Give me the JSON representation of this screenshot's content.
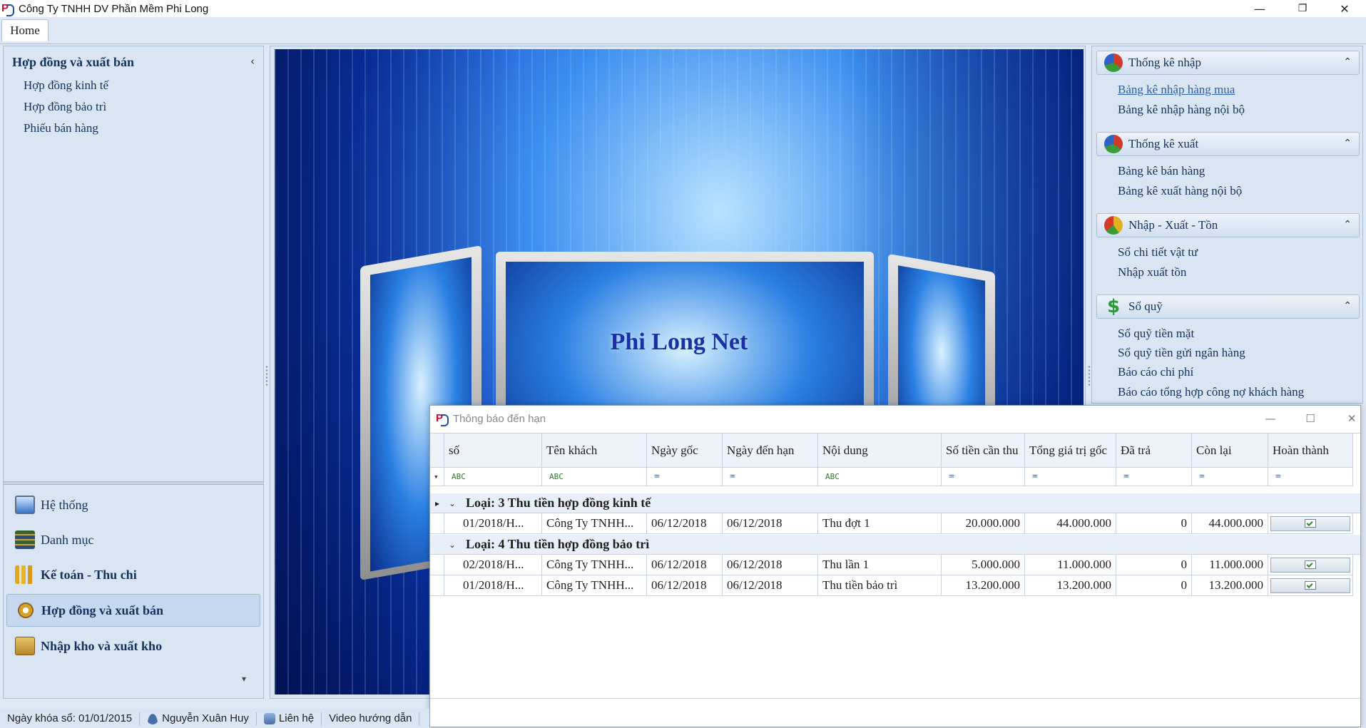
{
  "window": {
    "title": "Công Ty TNHH DV Phần Mềm Phi Long",
    "minimize": "—",
    "restore": "❐",
    "close": "✕"
  },
  "ribbon": {
    "home_tab": "Home"
  },
  "left_panel": {
    "heading": "Hợp đồng và xuất bán",
    "collapse_glyph": "‹",
    "links": [
      "Hợp đồng kinh tế",
      "Hợp đồng bảo trì",
      "Phiếu bán hàng"
    ],
    "modules": [
      {
        "label": "Hệ thống",
        "icon": "computer-icon"
      },
      {
        "label": "Danh mục",
        "icon": "books-icon"
      },
      {
        "label": "Kế toán - Thu chi",
        "icon": "chart-bars-icon"
      },
      {
        "label": "Hợp đồng và xuất bán",
        "icon": "gear-icon",
        "active": true
      },
      {
        "label": "Nhập kho và xuất kho",
        "icon": "warehouse-box-icon"
      }
    ],
    "scroll_glyph": "▾"
  },
  "banner": {
    "brand_text": "Phi Long Net"
  },
  "right_panel": {
    "groups": [
      {
        "title": "Thống kê nhập",
        "icon": "pie-chart-icon",
        "chevron": "⌃",
        "links": [
          "Bảng kê nhập hàng mua",
          "Bảng kê nhập hàng nội bộ"
        ]
      },
      {
        "title": "Thống kê xuất",
        "icon": "pie-chart-icon",
        "chevron": "⌃",
        "links": [
          "Bảng kê bán hàng",
          "Bảng kê xuất hàng nội bộ"
        ]
      },
      {
        "title": "Nhập - Xuất - Tồn",
        "icon": "pie-chart-3d-icon",
        "chevron": "⌃",
        "links": [
          "Sổ chi tiết vật tư",
          "Nhập xuất tồn"
        ]
      },
      {
        "title": "Sổ quỹ",
        "icon": "dollar-icon",
        "chevron": "⌃",
        "links": [
          "Sổ quỹ tiền mặt",
          "Sổ quỹ tiền gửi ngân hàng",
          "Báo cáo chi phí",
          "Báo cáo tổng hợp công nợ khách hàng"
        ]
      }
    ],
    "highlighted_link": "Bảng kê nhập hàng mua"
  },
  "dialog": {
    "title": "Thông báo đến hạn",
    "minimize": "—",
    "maximize": "☐",
    "close": "✕",
    "columns": [
      "số",
      "Tên khách",
      "Ngày gốc",
      "Ngày đến hạn",
      "Nội dung",
      "Số tiền cần thu",
      "Tổng giá trị gốc",
      "Đã trả",
      "Còn lại",
      "Hoàn thành"
    ],
    "filter_row": [
      "ABC",
      "ABC",
      "=",
      "=",
      "ABC",
      "=",
      "=",
      "=",
      "=",
      "="
    ],
    "filter_pin": "▾",
    "groups": [
      {
        "label": "Loại: 3 Thu tiền hợp đồng kinh tế",
        "rows": [
          [
            "01/2018/H...",
            "Công Ty TNHH...",
            "06/12/2018",
            "06/12/2018",
            "Thu đợt 1",
            "20.000.000",
            "44.000.000",
            "0",
            "44.000.000"
          ]
        ]
      },
      {
        "label": "Loại: 4 Thu tiền hợp đồng bảo trì",
        "rows": [
          [
            "02/2018/H...",
            "Công Ty TNHH...",
            "06/12/2018",
            "06/12/2018",
            "Thu lần 1",
            "5.000.000",
            "11.000.000",
            "0",
            "11.000.000"
          ],
          [
            "01/2018/H...",
            "Công Ty TNHH...",
            "06/12/2018",
            "06/12/2018",
            "Thu tiền bảo trì",
            "13.200.000",
            "13.200.000",
            "0",
            "13.200.000"
          ]
        ]
      }
    ],
    "group_expand_glyph": "⌄",
    "row_pointer": "▸"
  },
  "statusbar": {
    "lock_date": "Ngày khóa sổ: 01/01/2015",
    "user": "Nguyễn Xuân Huy",
    "contact": "Liên hệ",
    "video": "Video hướng dẫn"
  }
}
